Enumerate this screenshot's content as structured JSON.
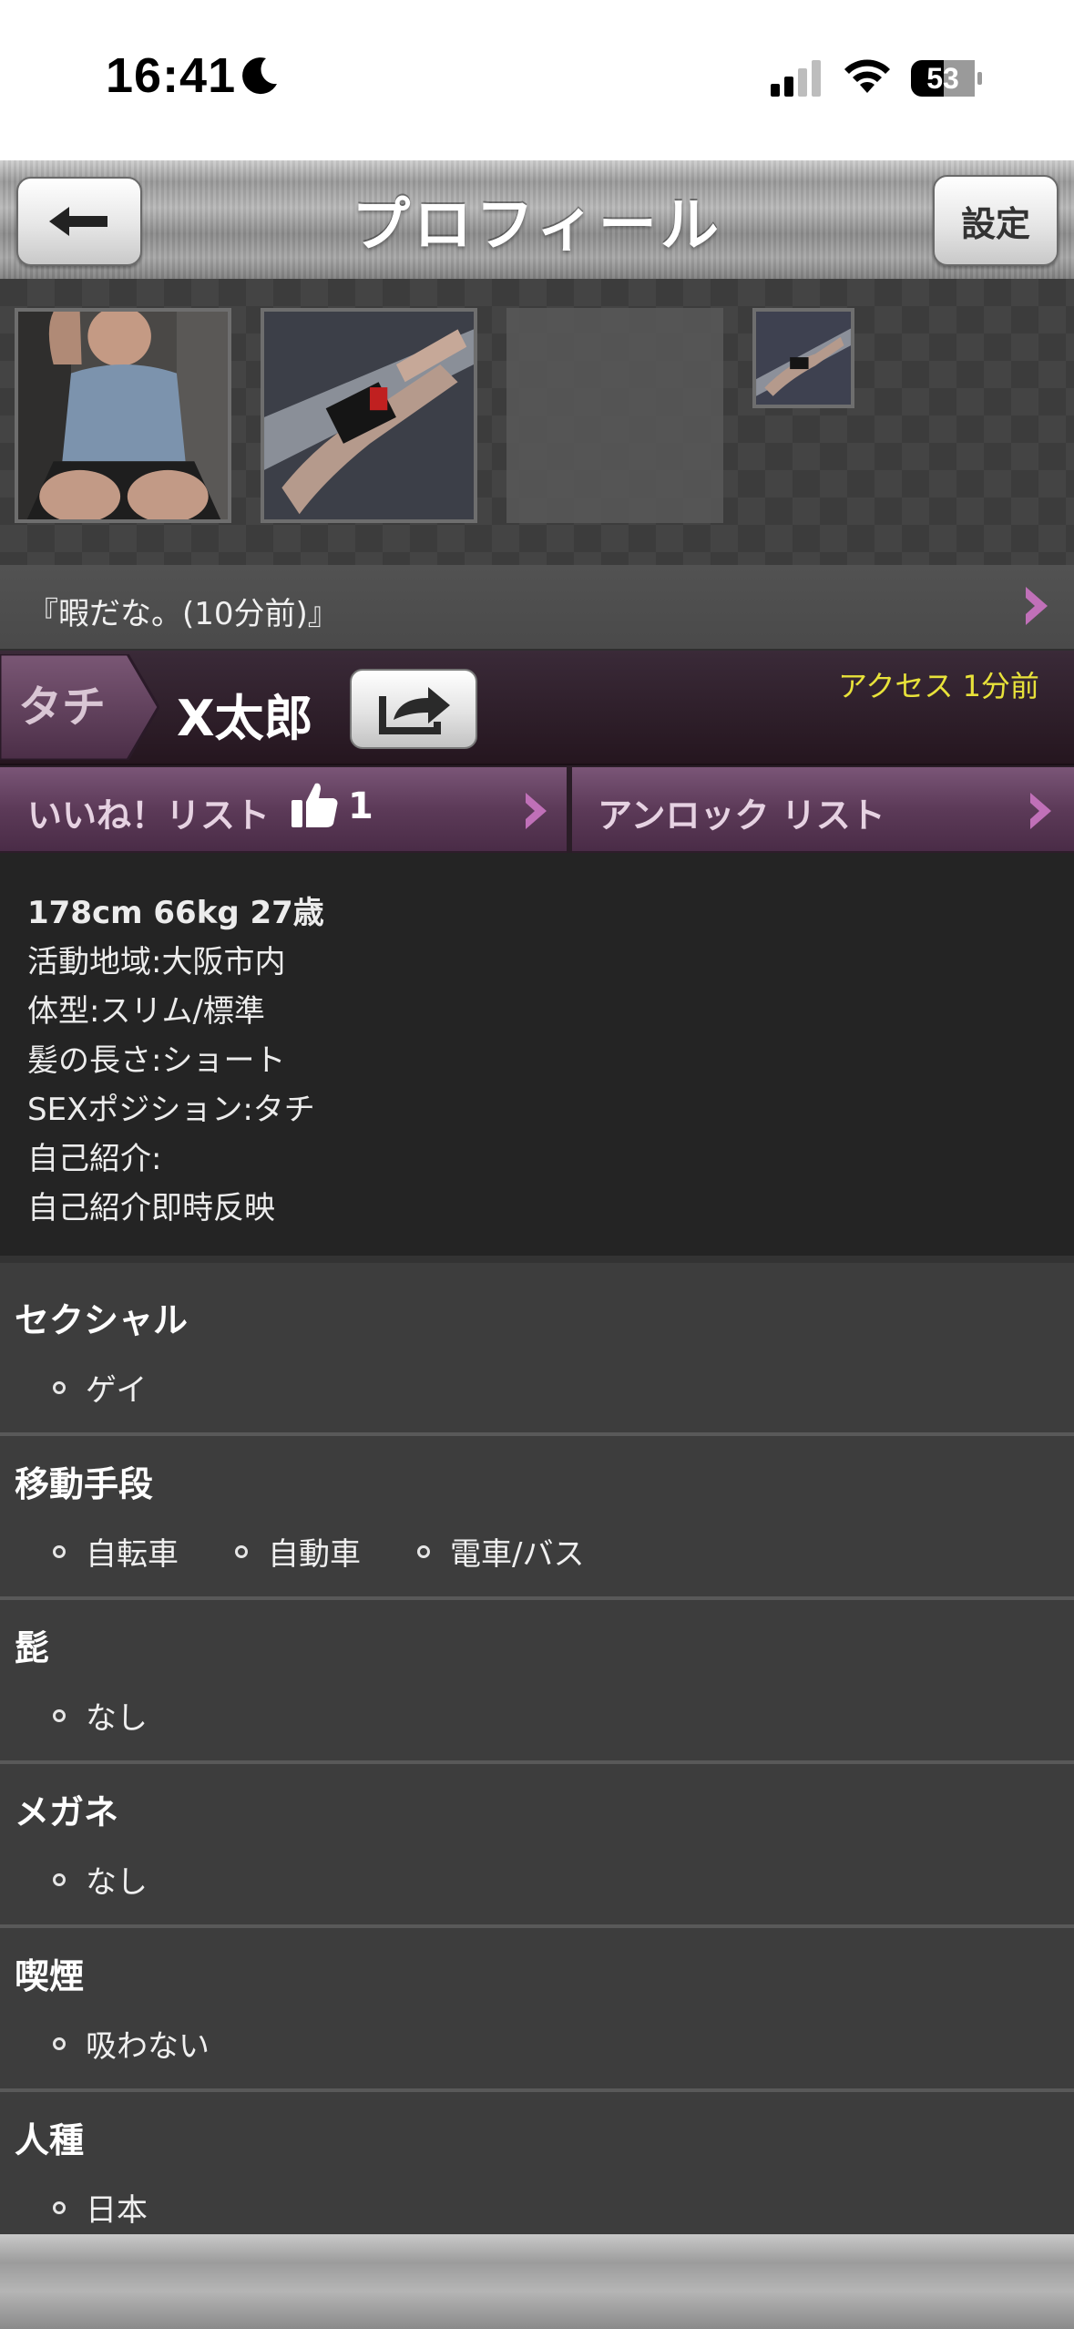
{
  "status_bar": {
    "time": "16:41",
    "battery": "53"
  },
  "navbar": {
    "title": "プロフィール",
    "settings_label": "設定"
  },
  "photos": {
    "count": 4
  },
  "status_message": "『暇だな。(10分前)』",
  "profile": {
    "position_tag": "タチ",
    "username": "X太郎",
    "access": "アクセス 1分前",
    "likes_label": "いいね！リスト",
    "likes_count": "1",
    "unlock_label": "アンロック リスト"
  },
  "info": {
    "stats": "178cm 66kg 27歳",
    "area": "活動地域:大阪市内",
    "body": "体型:スリム/標準",
    "hair": "髪の長さ:ショート",
    "position": "SEXポジション:タチ",
    "intro_label": "自己紹介:",
    "intro": "自己紹介即時反映"
  },
  "sections": [
    {
      "title": "セクシャル",
      "items": [
        "ゲイ"
      ]
    },
    {
      "title": "移動手段",
      "items": [
        "自転車",
        "自動車",
        "電車/バス"
      ]
    },
    {
      "title": "髭",
      "items": [
        "なし"
      ]
    },
    {
      "title": "メガネ",
      "items": [
        "なし"
      ]
    },
    {
      "title": "喫煙",
      "items": [
        "吸わない"
      ]
    },
    {
      "title": "人種",
      "items": [
        "日本"
      ]
    }
  ],
  "colors": {
    "accent_pink": "#c070b8",
    "access_yellow": "#e8e23a",
    "tag_bg": "#5a3a56"
  }
}
